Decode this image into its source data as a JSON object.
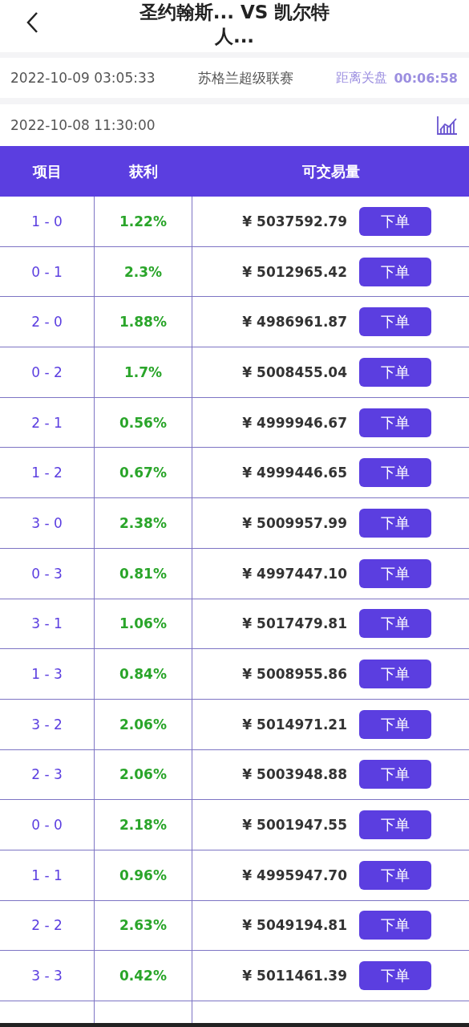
{
  "header": {
    "title": "圣约翰斯... VS 凯尔特人..."
  },
  "info": {
    "time": "2022-10-09 03:05:33",
    "league": "苏格兰超级联赛",
    "countdown_label": "距离关盘",
    "countdown": "00:06:58"
  },
  "match_time": "2022-10-08 11:30:00",
  "table": {
    "columns": [
      "项目",
      "获利",
      "可交易量"
    ],
    "rows": [
      {
        "score": "1 - 0",
        "profit": "1.22%",
        "volume": "¥ 5037592.79",
        "action": "下单"
      },
      {
        "score": "0 - 1",
        "profit": "2.3%",
        "volume": "¥ 5012965.42",
        "action": "下单"
      },
      {
        "score": "2 - 0",
        "profit": "1.88%",
        "volume": "¥ 4986961.87",
        "action": "下单"
      },
      {
        "score": "0 - 2",
        "profit": "1.7%",
        "volume": "¥ 5008455.04",
        "action": "下单"
      },
      {
        "score": "2 - 1",
        "profit": "0.56%",
        "volume": "¥ 4999946.67",
        "action": "下单"
      },
      {
        "score": "1 - 2",
        "profit": "0.67%",
        "volume": "¥ 4999446.65",
        "action": "下单"
      },
      {
        "score": "3 - 0",
        "profit": "2.38%",
        "volume": "¥ 5009957.99",
        "action": "下单"
      },
      {
        "score": "0 - 3",
        "profit": "0.81%",
        "volume": "¥ 4997447.10",
        "action": "下单"
      },
      {
        "score": "3 - 1",
        "profit": "1.06%",
        "volume": "¥ 5017479.81",
        "action": "下单"
      },
      {
        "score": "1 - 3",
        "profit": "0.84%",
        "volume": "¥ 5008955.86",
        "action": "下单"
      },
      {
        "score": "3 - 2",
        "profit": "2.06%",
        "volume": "¥ 5014971.21",
        "action": "下单"
      },
      {
        "score": "2 - 3",
        "profit": "2.06%",
        "volume": "¥ 5003948.88",
        "action": "下单"
      },
      {
        "score": "0 - 0",
        "profit": "2.18%",
        "volume": "¥ 5001947.55",
        "action": "下单"
      },
      {
        "score": "1 - 1",
        "profit": "0.96%",
        "volume": "¥ 4995947.70",
        "action": "下单"
      },
      {
        "score": "2 - 2",
        "profit": "2.63%",
        "volume": "¥ 5049194.81",
        "action": "下单"
      },
      {
        "score": "3 - 3",
        "profit": "0.42%",
        "volume": "¥ 5011461.39",
        "action": "下单"
      }
    ]
  }
}
